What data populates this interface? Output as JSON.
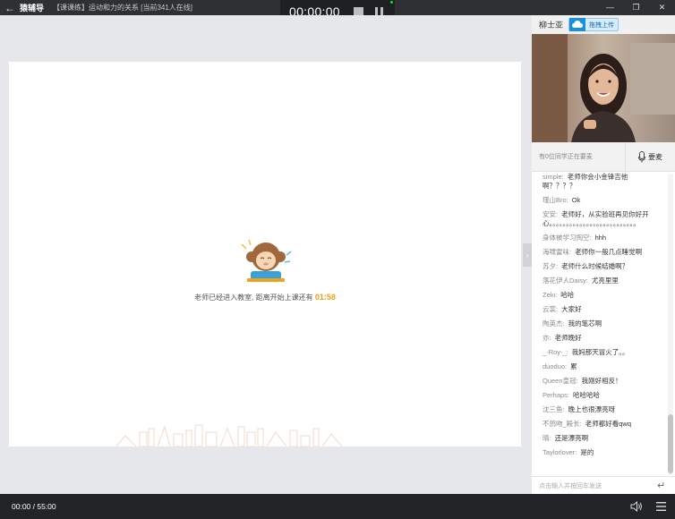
{
  "titlebar": {
    "back": "←",
    "app_name": "猿辅导",
    "subtitle": "【课课练】运动和力的关系 [当前341人在线]",
    "min": "—",
    "max": "❐",
    "close": "✕"
  },
  "recorder": {
    "time": "00:00:00"
  },
  "board": {
    "waiting_text": "老师已经进入教室, 距离开始上课还有",
    "countdown": "01:58"
  },
  "side_toggle": "›",
  "panel": {
    "teacher_name": "柳士亚",
    "upload_label": "拖拽上传",
    "mic_status": "有0位同学正在要麦",
    "mic_label": "要麦",
    "chat_placeholder": "点击输入并按回车发送",
    "enter_icon": "↵"
  },
  "chat": [
    {
      "user": "simple:",
      "text": "老师你会小金锋吉他啊？？？？"
    },
    {
      "user": "瑾山Bro:",
      "text": "Ok"
    },
    {
      "user": "安安:",
      "text": "老师好，从实验班再见你好开心。。。。。。。。。。。。。。。。。。。。。。。。。。"
    },
    {
      "user": "身体被学习掏空:",
      "text": "hhh"
    },
    {
      "user": "海啸雷味:",
      "text": "老师你一般几点睡觉啊"
    },
    {
      "user": "苏夕:",
      "text": "老师什么时候结婚啊？"
    },
    {
      "user": "落花伊人Daisy:",
      "text": "尤亮里里"
    },
    {
      "user": "Zeki:",
      "text": "哈哈"
    },
    {
      "user": "云裳:",
      "text": "大家好"
    },
    {
      "user": "陶英杰:",
      "text": "我的笔芯啊"
    },
    {
      "user": "亦:",
      "text": "老师晚好"
    },
    {
      "user": "_-Roy-_:",
      "text": "我妈那天冒火了。。"
    },
    {
      "user": "duoduo:",
      "text": "累"
    },
    {
      "user": "Queen皇冠:",
      "text": "我刚好相反！"
    },
    {
      "user": "Perhaps:",
      "text": "哈哈哈哈"
    },
    {
      "user": "沈三鱼:",
      "text": "晚上也很漂亮呀"
    },
    {
      "user": "不鸽吻_殿长:",
      "text": "老师都好看qwq"
    },
    {
      "user": "晴:",
      "text": "还是漂亮啊"
    },
    {
      "user": "Taylorlover:",
      "text": "是的"
    }
  ],
  "bottombar": {
    "playtime": "00:00 / 55:00"
  },
  "colors": {
    "countdown": "#f0a21b",
    "upload_blue": "#1a8fe0",
    "titlebar": "#2e3034"
  }
}
